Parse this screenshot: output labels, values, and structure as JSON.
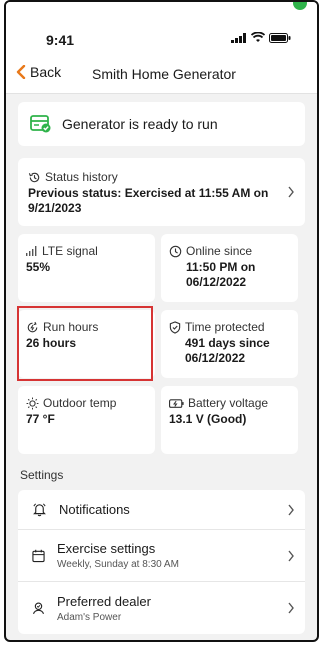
{
  "status_bar": {
    "time": "9:41"
  },
  "nav": {
    "back_label": "Back",
    "title": "Smith Home Generator"
  },
  "ready": {
    "text": "Generator is ready to run"
  },
  "history": {
    "label": "Status history",
    "value": "Previous status: Exercised at 11:55 AM on 9/21/2023"
  },
  "tiles": [
    {
      "label": "LTE signal",
      "value": "55%"
    },
    {
      "label": "Online since",
      "value": "11:50 PM on 06/12/2022"
    },
    {
      "label": "Run hours",
      "value": "26 hours"
    },
    {
      "label": "Time protected",
      "value": "491 days since 06/12/2022"
    },
    {
      "label": "Outdoor temp",
      "value": "77 °F"
    },
    {
      "label": "Battery voltage",
      "value": "13.1 V (Good)"
    }
  ],
  "settings": {
    "section_label": "Settings",
    "items": [
      {
        "title": "Notifications",
        "subtitle": ""
      },
      {
        "title": "Exercise settings",
        "subtitle": "Weekly, Sunday at 8:30 AM"
      },
      {
        "title": "Preferred dealer",
        "subtitle": "Adam's Power"
      }
    ]
  },
  "colors": {
    "accent": "#e8791a",
    "success": "#2fb34a",
    "highlight": "#d63434"
  }
}
